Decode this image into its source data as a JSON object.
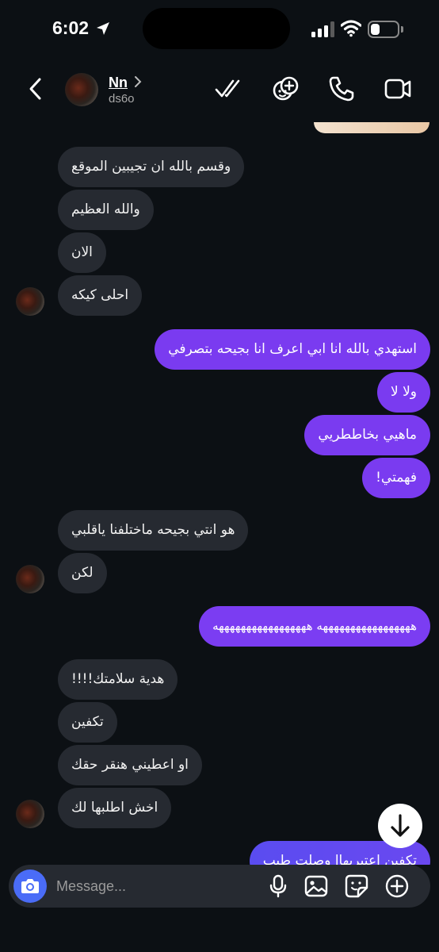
{
  "status": {
    "time": "6:02",
    "battery_level": 0.35
  },
  "header": {
    "contact_name": "Nn",
    "username": "ds6o",
    "icons": [
      "back-chevron-icon",
      "double-check-icon",
      "effects-icon",
      "phone-icon",
      "video-camera-icon"
    ]
  },
  "messages": [
    {
      "direction": "in",
      "text": "وقسم بالله ان تجيبين الموقع"
    },
    {
      "direction": "in",
      "text": "والله العظيم"
    },
    {
      "direction": "in",
      "text": "الان"
    },
    {
      "direction": "in",
      "text": "احلى كيكه"
    },
    {
      "direction": "out",
      "text": "استهدي بالله انا ابي اعرف انا بجيحه بتصرفي"
    },
    {
      "direction": "out",
      "text": "ولا لا"
    },
    {
      "direction": "out",
      "text": "ماهيي بخاططريي"
    },
    {
      "direction": "out",
      "text": "فهمتي!"
    },
    {
      "direction": "in",
      "text": "هو انتي بجيحه ماختلفنا ياقلبي"
    },
    {
      "direction": "in",
      "text": "لكن"
    },
    {
      "direction": "out",
      "text": "هههههههههههههههههه هههههههههههههههههه"
    },
    {
      "direction": "in",
      "text": "هدية سلامتك!!!!"
    },
    {
      "direction": "in",
      "text": "تكفين"
    },
    {
      "direction": "in",
      "text": "او اعطيني هنقر حقك"
    },
    {
      "direction": "in",
      "text": "اخش اطلبها لك"
    },
    {
      "direction": "out",
      "text": "تكفين اعتبريهاا وصلت طيب"
    }
  ],
  "composer": {
    "placeholder": "Message...",
    "icons": [
      "camera-icon",
      "microphone-icon",
      "gallery-icon",
      "sticker-icon",
      "add-icon"
    ]
  },
  "colors": {
    "outgoing": "#7a3bf0",
    "incoming": "#262a31",
    "background": "#0c1014",
    "camera_button": "#4a6cf7"
  }
}
